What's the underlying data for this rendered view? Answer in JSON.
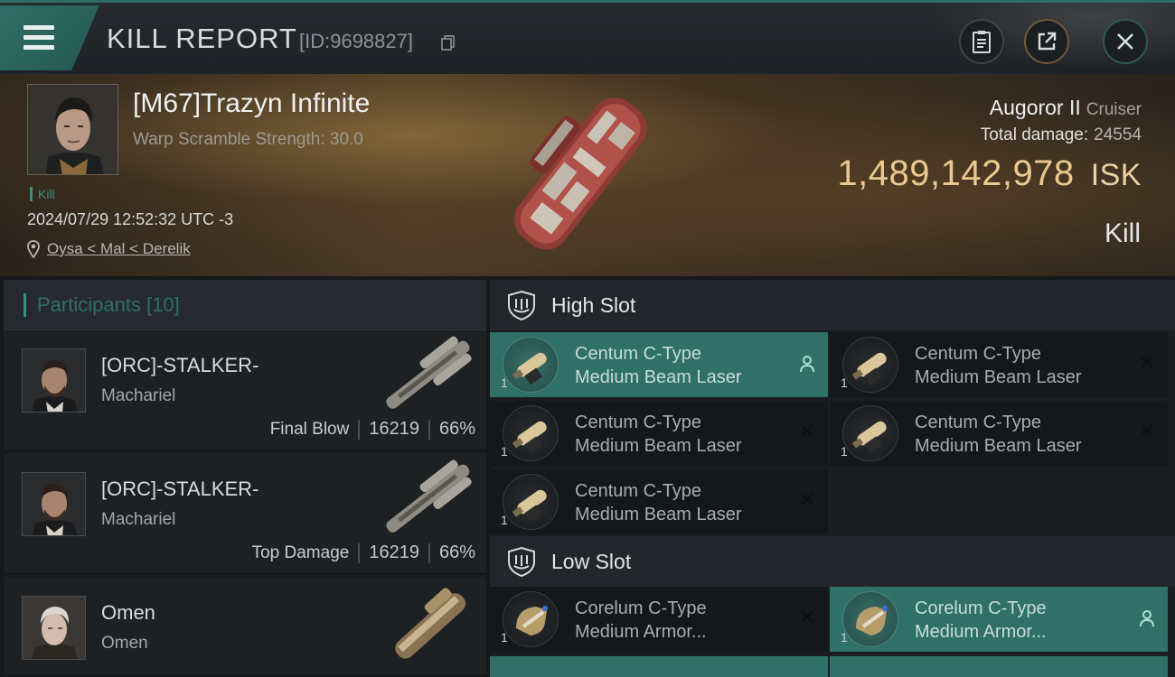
{
  "header": {
    "title": "KILL REPORT",
    "id_text": "[ID:9698827]",
    "menu_icon": "menu-icon",
    "actions": [
      {
        "name": "report-button",
        "icon": "clipboard-icon"
      },
      {
        "name": "share-button",
        "icon": "share-icon"
      },
      {
        "name": "close-button",
        "icon": "close-icon"
      }
    ]
  },
  "victim": {
    "name": "[M67]Trazyn Infinite",
    "warp_scramble": "Warp Scramble Strength: 30.0",
    "tag": "Kill",
    "timestamp": "2024/07/29 12:52:32 UTC -3",
    "location": "Oysa < Mal < Derelik",
    "ship_name": "Augoror II",
    "ship_class": "Cruiser",
    "total_damage_label": "Total damage:",
    "total_damage": "24554",
    "isk_value": "1,489,142,978",
    "isk_unit": "ISK",
    "result": "Kill"
  },
  "participants": {
    "title": "Participants",
    "count": "[10]",
    "rows": [
      {
        "name": "[ORC]-STALKER-",
        "ship": "Machariel",
        "role": "Final Blow",
        "damage": "16219",
        "percent": "66%"
      },
      {
        "name": "[ORC]-STALKER-",
        "ship": "Machariel",
        "role": "Top Damage",
        "damage": "16219",
        "percent": "66%"
      },
      {
        "name": "Omen",
        "ship": "Omen",
        "role": "",
        "damage": "",
        "percent": ""
      }
    ]
  },
  "high_slot": {
    "title": "High Slot",
    "modules": [
      {
        "line1": "Centum C-Type",
        "line2": "Medium Beam Laser",
        "qty": "1",
        "state": "active"
      },
      {
        "line1": "Centum C-Type",
        "line2": "Medium Beam Laser",
        "qty": "1",
        "state": "destroyed"
      },
      {
        "line1": "Centum C-Type",
        "line2": "Medium Beam Laser",
        "qty": "1",
        "state": "destroyed"
      },
      {
        "line1": "Centum C-Type",
        "line2": "Medium Beam Laser",
        "qty": "1",
        "state": "destroyed"
      },
      {
        "line1": "Centum C-Type",
        "line2": "Medium Beam Laser",
        "qty": "1",
        "state": "destroyed"
      }
    ]
  },
  "low_slot": {
    "title": "Low Slot",
    "modules": [
      {
        "line1": "Corelum C-Type",
        "line2": "Medium Armor...",
        "qty": "1",
        "state": "destroyed"
      },
      {
        "line1": "Corelum C-Type",
        "line2": "Medium Armor...",
        "qty": "1",
        "state": "active"
      }
    ]
  },
  "icons": {
    "active_module": "person-icon",
    "destroyed_module": "x-icon",
    "location": "pin-icon",
    "slot": "shield-icon"
  },
  "colors": {
    "accent": "#2f7069",
    "isk": "#e9c98d",
    "banner": "#4a3a26"
  }
}
